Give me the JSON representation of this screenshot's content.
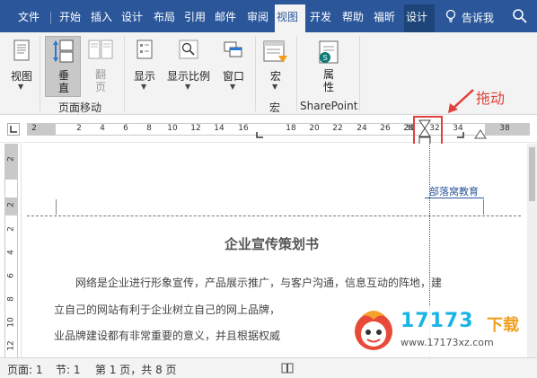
{
  "tabs": [
    "文件",
    "开始",
    "插入",
    "设计",
    "布局",
    "引用",
    "邮件",
    "审阅",
    "视图",
    "开发",
    "帮助",
    "福昕",
    "设计"
  ],
  "tellme": "告诉我",
  "ribbon": {
    "view": "视图",
    "vertical": "垂\n直",
    "page_flip": "翻\n页",
    "group_page_move": "页面移动",
    "show": "显示",
    "zoom": "显示比例",
    "window": "窗口",
    "macro": "宏",
    "group_macro": "宏",
    "property": "属\n性",
    "group_sharepoint": "SharePoint"
  },
  "annotation": "拖动",
  "ruler_numbers": [
    "2",
    "2",
    "4",
    "6",
    "8",
    "10",
    "12",
    "14",
    "16",
    "18",
    "20",
    "22",
    "24",
    "26",
    "28",
    "30",
    "32",
    "34",
    "38"
  ],
  "vruler_numbers": [
    "2",
    "2",
    "2",
    "4",
    "6",
    "8",
    "10",
    "12"
  ],
  "document": {
    "header_text": "部落窝教育",
    "title": "企业宣传策划书",
    "lines": [
      "网络是企业进行形象宣传，产品展示推广，与客户沟通，信息互动的阵地，建",
      "立自己的网站有利于企业树立自己的网上品牌，",
      "业品牌建设都有非常重要的意义，并且根据权威"
    ]
  },
  "watermark": {
    "number": "17173",
    "download": "下载",
    "url": "www.17173xz.com"
  },
  "status": {
    "page": "页面: 1",
    "section": "节: 1",
    "pages": "第 1 页，共 8 页"
  },
  "colors": {
    "title_bar": "#2b579a",
    "annotation": "#e0403a",
    "ribbon": "#f3f3f3"
  }
}
